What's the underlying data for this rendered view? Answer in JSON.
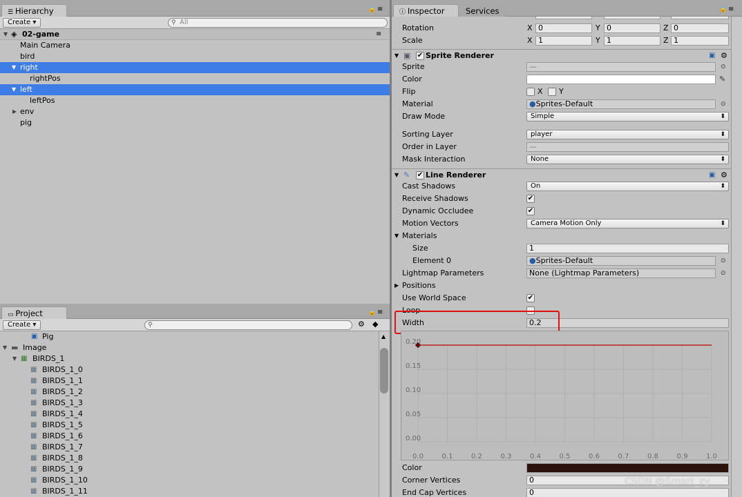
{
  "hierarchy": {
    "tab": "Hierarchy",
    "create": "Create",
    "search_placeholder": "All",
    "scene": "02-game",
    "items": [
      {
        "label": "Main Camera"
      },
      {
        "label": "bird"
      },
      {
        "label": "right"
      },
      {
        "label": "rightPos"
      },
      {
        "label": "left"
      },
      {
        "label": "leftPos"
      },
      {
        "label": "env"
      },
      {
        "label": "pig"
      }
    ]
  },
  "project": {
    "tab": "Project",
    "create": "Create",
    "items": [
      {
        "label": "Pig"
      },
      {
        "label": "Image"
      },
      {
        "label": "BIRDS_1"
      },
      {
        "label": "BIRDS_1_0"
      },
      {
        "label": "BIRDS_1_1"
      },
      {
        "label": "BIRDS_1_2"
      },
      {
        "label": "BIRDS_1_3"
      },
      {
        "label": "BIRDS_1_4"
      },
      {
        "label": "BIRDS_1_5"
      },
      {
        "label": "BIRDS_1_6"
      },
      {
        "label": "BIRDS_1_7"
      },
      {
        "label": "BIRDS_1_8"
      },
      {
        "label": "BIRDS_1_9"
      },
      {
        "label": "BIRDS_1_10"
      },
      {
        "label": "BIRDS_1_11"
      }
    ]
  },
  "inspector": {
    "tab": "Inspector",
    "tab2": "Services",
    "transform": {
      "rotation_label": "Rotation",
      "rotation": {
        "x": "0",
        "y": "0",
        "z": "0"
      },
      "scale_label": "Scale",
      "scale": {
        "x": "1",
        "y": "1",
        "z": "1"
      },
      "x": "X",
      "y": "Y",
      "z": "Z"
    },
    "sprite_renderer": {
      "title": "Sprite Renderer",
      "sprite_label": "Sprite",
      "sprite": "—",
      "color_label": "Color",
      "flip_label": "Flip",
      "flip_x": "X",
      "flip_y": "Y",
      "material_label": "Material",
      "material": "Sprites-Default",
      "draw_mode_label": "Draw Mode",
      "draw_mode": "Simple",
      "sorting_layer_label": "Sorting Layer",
      "sorting_layer": "player",
      "order_label": "Order in Layer",
      "order": "—",
      "mask_label": "Mask Interaction",
      "mask": "None"
    },
    "line_renderer": {
      "title": "Line Renderer",
      "cast_shadows_label": "Cast Shadows",
      "cast_shadows": "On",
      "receive_shadows_label": "Receive Shadows",
      "dynamic_occludee_label": "Dynamic Occludee",
      "motion_vectors_label": "Motion Vectors",
      "motion_vectors": "Camera Motion Only",
      "materials_label": "Materials",
      "size_label": "Size",
      "size": "1",
      "element0_label": "Element 0",
      "element0": "Sprites-Default",
      "lightmap_label": "Lightmap Parameters",
      "lightmap": "None (Lightmap Parameters)",
      "positions_label": "Positions",
      "world_space_label": "Use World Space",
      "loop_label": "Loop",
      "width_label": "Width",
      "width": "0.2",
      "color_label": "Color",
      "corner_label": "Corner Vertices",
      "corner": "0",
      "endcap_label": "End Cap Vertices",
      "endcap": "0"
    }
  },
  "chart_data": {
    "type": "line",
    "x": [
      0.0,
      1.0
    ],
    "series": [
      {
        "values": [
          0.2,
          0.2
        ]
      }
    ],
    "xticks": [
      "0.0",
      "0.1",
      "0.2",
      "0.3",
      "0.4",
      "0.5",
      "0.6",
      "0.7",
      "0.8",
      "0.9",
      "1.0"
    ],
    "yticks": [
      "0.20",
      "0.15",
      "0.10",
      "0.05",
      "0.00"
    ],
    "xlim": [
      0,
      1
    ],
    "ylim": [
      0,
      0.2
    ],
    "grid": true,
    "line_color": "#c00000"
  },
  "colors": {
    "selection": "#3e7de7",
    "highlight_box": "#e01010",
    "line_color_swatch": "#2b120a"
  },
  "watermark": "CSDN @Smart_zy"
}
